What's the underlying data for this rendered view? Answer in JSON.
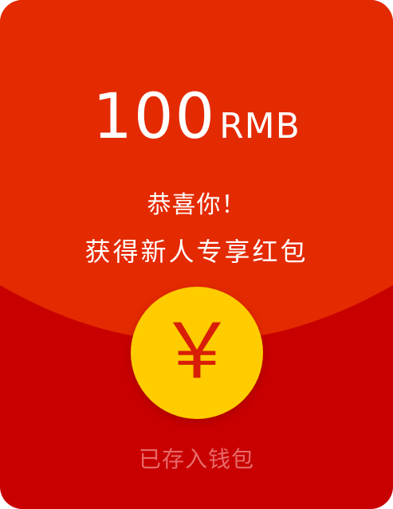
{
  "envelope": {
    "amount_value": "100",
    "amount_unit": "RMB",
    "greeting": "恭喜你！",
    "subtitle": "获得新人专享红包",
    "coin_symbol": "￥",
    "status_text": "已存入钱包"
  },
  "colors": {
    "top_red": "#e42a00",
    "bottom_red": "#c80000",
    "coin_yellow": "#ffcc00",
    "coin_symbol_red": "#d81e06",
    "status_text_color": "#e86a6a"
  },
  "icons": {
    "coin": "yuan-coin-icon"
  }
}
